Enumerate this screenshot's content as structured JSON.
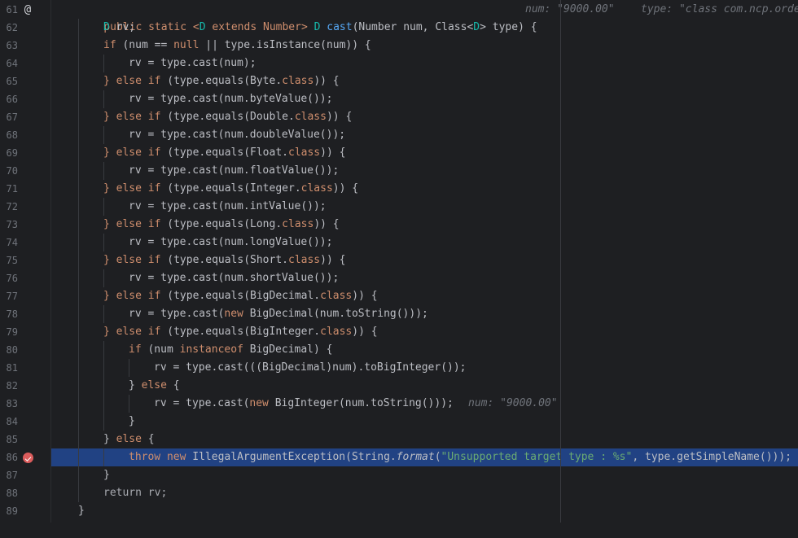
{
  "editor": {
    "line_numbers": [
      "61",
      "62",
      "63",
      "64",
      "65",
      "66",
      "67",
      "68",
      "69",
      "70",
      "71",
      "72",
      "73",
      "74",
      "75",
      "76",
      "77",
      "78",
      "79",
      "80",
      "81",
      "82",
      "83",
      "84",
      "85",
      "86",
      "87",
      "88",
      "89"
    ],
    "gutter_icons": {
      "line61": "@",
      "line86": "breakpoint-icon"
    },
    "inlay_hints": {
      "num_hint": "num: \"9000.00\"",
      "type_hint": "type: \"class com.ncp.orde",
      "num_hint_83": "num: \"9000.00\""
    },
    "code": {
      "l61_a": "public static <",
      "l61_b": "D",
      "l61_c": " extends Number> ",
      "l61_d": "D",
      "l61_e": " ",
      "l61_f": "cast",
      "l61_g": "(Number num, Class<",
      "l61_h": "D",
      "l61_i": "> type) {",
      "l62_a": "D",
      "l62_b": " rv;",
      "l63_a": "if",
      "l63_b": " (num == ",
      "l63_c": "null",
      "l63_d": " || type.isInstance(num)) {",
      "l64": "rv = type.cast(num);",
      "else_if": "} else if",
      "cls": "class",
      "l65_a": " (type.equals(Byte.",
      "l65_b": ")) {",
      "l66": "rv = type.cast(num.byteValue());",
      "l67_a": " (type.equals(Double.",
      "l68": "rv = type.cast(num.doubleValue());",
      "l69_a": " (type.equals(Float.",
      "l70": "rv = type.cast(num.floatValue());",
      "l71_a": " (type.equals(Integer.",
      "l72": "rv = type.cast(num.intValue());",
      "l73_a": " (type.equals(Long.",
      "l74": "rv = type.cast(num.longValue());",
      "l75_a": " (type.equals(Short.",
      "l76": "rv = type.cast(num.shortValue());",
      "l77_a": " (type.equals(BigDecimal.",
      "l78_a": "rv = type.cast(",
      "kw_new": "new",
      "l78_b": " BigDecimal(num.toString()));",
      "l79_a": " (type.equals(BigInteger.",
      "l80_a": "if",
      "l80_b": " (num ",
      "l80_c": "instanceof",
      "l80_d": " BigDecimal) {",
      "l81": "rv = type.cast(((BigDecimal)num).toBigInteger());",
      "l82_a": "} ",
      "kw_else": "else",
      "l82_b": " {",
      "l83_a": "rv = type.cast(",
      "l83_b": " BigInteger(num.toString()));",
      "l84": "}",
      "l85_a": "} ",
      "l85_b": " {",
      "kw_throw": "throw",
      "l86_a": " IllegalArgumentException(String.",
      "l86_b": "format",
      "l86_c": "(",
      "l86_d": "\"Unsupported target type : %s\"",
      "l86_e": ", type.getSimpleName()));",
      "l87": "}",
      "l88": "return rv;",
      "l89": "}"
    }
  },
  "colors": {
    "background": "#1e1f22",
    "keyword": "#cf8e6d",
    "type_param": "#16baac",
    "method": "#56a8f5",
    "string": "#6aab73",
    "highlight": "#214283",
    "line_number": "#6f737a"
  }
}
